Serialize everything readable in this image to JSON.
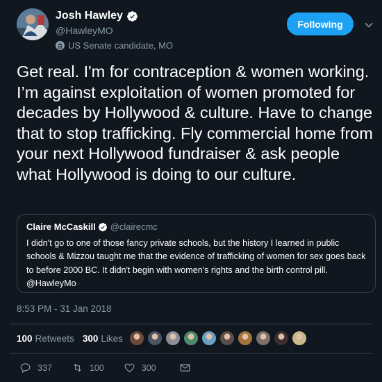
{
  "author": {
    "display_name": "Josh Hawley",
    "handle": "@HawleyMO",
    "label": "US Senate candidate, MO",
    "avatar_icon": "profile-photo"
  },
  "follow_button": {
    "label": "Following",
    "color": "#1da1f2"
  },
  "tweet": {
    "text": "Get real. I'm for contraception & women working. I’m against exploitation of women promoted for decades by Hollywood & culture. Have to change that to stop trafficking. Fly commercial home from your next Hollywood fundraiser & ask people what Hollywood is doing to our culture."
  },
  "quoted_tweet": {
    "display_name": "Claire McCaskill",
    "handle": "@clairecmc",
    "text": "I didn't go to one of those fancy private schools, but the history I learned in public schools & Mizzou taught me that the evidence of trafficking of women for sex goes back to before 2000 BC. It didn't begin with women's rights and the birth control pill. @HawleyMo"
  },
  "timestamp": "8:53 PM - 31 Jan 2018",
  "stats": {
    "retweets_count": "100",
    "retweets_label": "Retweets",
    "likes_count": "300",
    "likes_label": "Likes"
  },
  "likers": [
    "#6b4a3a",
    "#4a5566",
    "#8a8f96",
    "#4d8a6a",
    "#6a9fc4",
    "#5a4e48",
    "#a4723c",
    "#7a6f6a",
    "#3a2e2e",
    "#c9b98a"
  ],
  "actions": {
    "replies": "337",
    "retweets": "100",
    "likes": "300"
  },
  "theme": {
    "background": "#10171e",
    "muted": "#8899a6",
    "border": "#38444d",
    "accent": "#1da1f2"
  }
}
